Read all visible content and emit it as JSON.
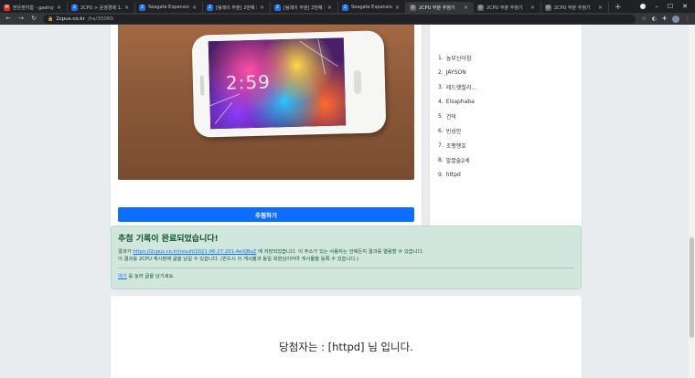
{
  "browser": {
    "tabs": [
      {
        "title": "받은편지함 - gaehiyu...",
        "favicon_color": "#d93025",
        "favicon_glyph": "M"
      },
      {
        "title": "2CPU > 운영경매 1.리...",
        "favicon_color": "#1a73e8",
        "favicon_glyph": "2"
      },
      {
        "title": "Seagate Expansion Po...",
        "favicon_color": "#1a73e8",
        "favicon_glyph": "2"
      },
      {
        "title": "[팀레이 무분] 2번째 회...",
        "favicon_color": "#1a73e8",
        "favicon_glyph": "2"
      },
      {
        "title": "[팀레이 무분] 2번째 회...",
        "favicon_color": "#1a73e8",
        "favicon_glyph": "2"
      },
      {
        "title": "Seagate Expansion Po...",
        "favicon_color": "#1a73e8",
        "favicon_glyph": "2"
      },
      {
        "title": "2CPU 무분 추첨기",
        "favicon_color": "#5f6368",
        "favicon_glyph": "◎",
        "active": true
      },
      {
        "title": "2CPU 무분 추첨기",
        "favicon_color": "#5f6368",
        "favicon_glyph": "◎"
      },
      {
        "title": "2CPU 무분 추첨기",
        "favicon_color": "#5f6368",
        "favicon_glyph": "◎"
      }
    ],
    "new_tab_label": "+",
    "url_host": "2cpus.co.kr",
    "url_path": "/ha/35089"
  },
  "draw_button_label": "추첨하기",
  "ranking": [
    {
      "num": "1.",
      "name": "높부신아침"
    },
    {
      "num": "2.",
      "name": "JAYSON"
    },
    {
      "num": "3.",
      "name": "레드햇칠리..."
    },
    {
      "num": "4.",
      "name": "Elsaphaba"
    },
    {
      "num": "5.",
      "name": "건덕"
    },
    {
      "num": "6.",
      "name": "빈성안"
    },
    {
      "num": "7.",
      "name": "조행행호"
    },
    {
      "num": "8.",
      "name": "발꿀술2세"
    },
    {
      "num": "9.",
      "name": "httpd"
    }
  ],
  "photo": {
    "clock": "2:59"
  },
  "alert": {
    "heading": "추첨 기록이 완료되었습니다!",
    "line1_prefix": "결과가",
    "result_link": "https://2cpus.co.kr/result/2021-06-27-201-AeXJBoZ",
    "line1_suffix": "에 저장되었습니다. 이 주소가 있는 사용자는 언제든지 결과를 열람할 수 있습니다.",
    "line2": "이 결과를 2CPU 게시판에 글을 남길 수 있습니다. (반드시 이 게시물과 동일 회원님이어야 게시물을 등록 수 있습니다.)",
    "here_link": "여기",
    "line3_suffix": "를 눌러 글을 남기세요."
  },
  "winner_text": "당첨자는 : [httpd] 님 입니다."
}
